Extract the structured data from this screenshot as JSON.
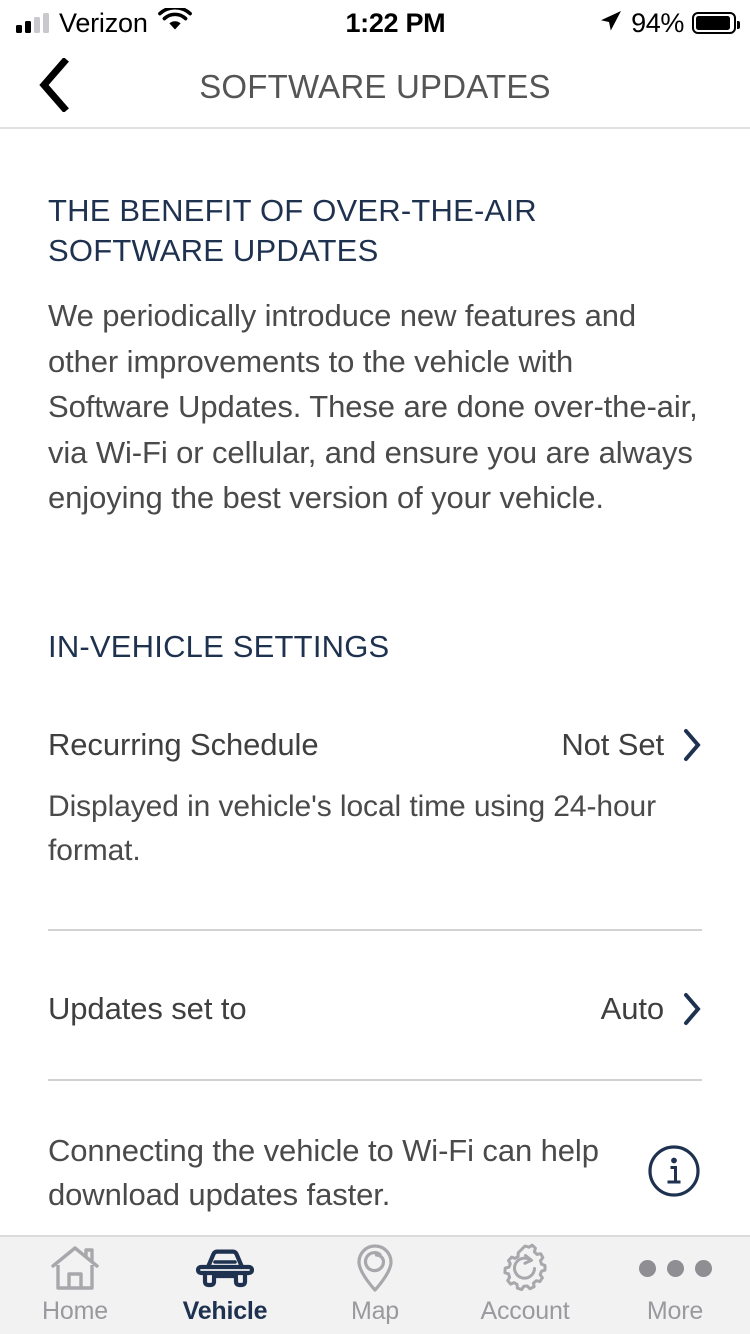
{
  "status_bar": {
    "carrier": "Verizon",
    "signal_bars_total": 4,
    "signal_bars_filled": 2,
    "wifi_icon": "wifi-icon",
    "time": "1:22 PM",
    "location_icon": "location-arrow-icon",
    "battery_percent": "94%",
    "battery_level": 94
  },
  "nav": {
    "back_icon": "chevron-left-icon",
    "title": "SOFTWARE UPDATES"
  },
  "main": {
    "benefit_heading": "THE BENEFIT OF OVER-THE-AIR SOFTWARE UPDATES",
    "benefit_body": "We periodically introduce new features and other improvements to the vehicle with Software Updates. These are done over-the-air, via Wi-Fi or cellular, and ensure you are always enjoying the best version of your vehicle.",
    "settings_heading": "IN-VEHICLE SETTINGS",
    "rows": [
      {
        "label": "Recurring Schedule",
        "value": "Not Set",
        "chevron_icon": "chevron-right-icon",
        "note": "Displayed in vehicle's local time using 24-hour format."
      },
      {
        "label": "Updates set to",
        "value": "Auto",
        "chevron_icon": "chevron-right-icon",
        "note": ""
      }
    ],
    "wifi_note": "Connecting the vehicle to Wi-Fi can help download updates faster.",
    "info_icon": "info-circle-icon"
  },
  "tabbar": {
    "items": [
      {
        "label": "Home",
        "icon": "home-icon",
        "active": false
      },
      {
        "label": "Vehicle",
        "icon": "car-icon",
        "active": true
      },
      {
        "label": "Map",
        "icon": "map-pin-icon",
        "active": false
      },
      {
        "label": "Account",
        "icon": "gear-icon",
        "active": false
      },
      {
        "label": "More",
        "icon": "ellipsis-icon",
        "active": false
      }
    ]
  },
  "colors": {
    "navy": "#1e3250",
    "body_gray": "#4a4a4a",
    "title_gray": "#555555",
    "inactive_gray": "#9a9a9e",
    "divider": "#d2d2d2",
    "tabbar_bg": "#f2f2f2"
  }
}
